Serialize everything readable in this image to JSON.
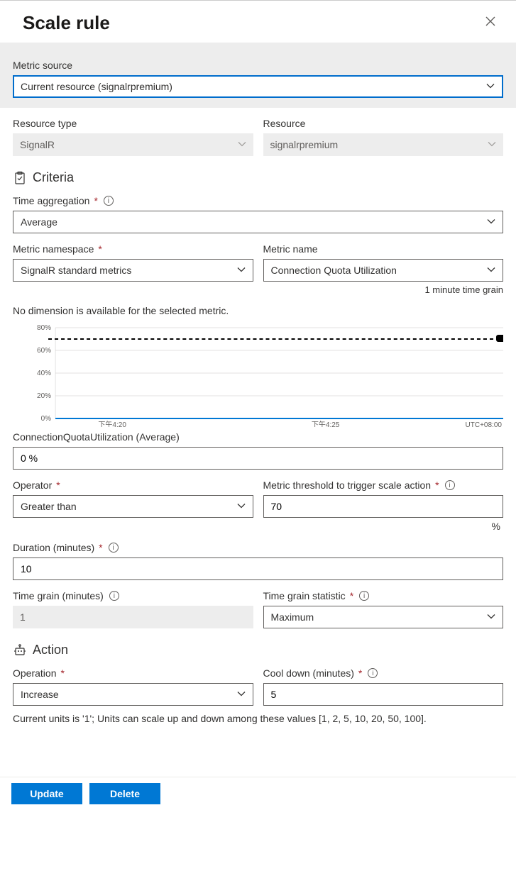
{
  "header": {
    "title": "Scale rule"
  },
  "metric_source": {
    "label": "Metric source",
    "value": "Current resource (signalrpremium)"
  },
  "resource_type": {
    "label": "Resource type",
    "value": "SignalR"
  },
  "resource": {
    "label": "Resource",
    "value": "signalrpremium"
  },
  "criteria": {
    "heading": "Criteria",
    "time_aggregation": {
      "label": "Time aggregation",
      "value": "Average"
    },
    "metric_namespace": {
      "label": "Metric namespace",
      "value": "SignalR standard metrics"
    },
    "metric_name": {
      "label": "Metric name",
      "value": "Connection Quota Utilization",
      "hint": "1 minute time grain"
    },
    "dimension_note": "No dimension is available for the selected metric.",
    "chart_legend": "ConnectionQuotaUtilization (Average)",
    "current_value": "0 %",
    "operator": {
      "label": "Operator",
      "value": "Greater than"
    },
    "threshold": {
      "label": "Metric threshold to trigger scale action",
      "value": "70",
      "unit": "%"
    },
    "duration": {
      "label": "Duration (minutes)",
      "value": "10"
    },
    "time_grain": {
      "label": "Time grain (minutes)",
      "value": "1"
    },
    "time_grain_statistic": {
      "label": "Time grain statistic",
      "value": "Maximum"
    }
  },
  "chart_data": {
    "type": "line",
    "title": "",
    "xlabel": "",
    "ylabel": "",
    "ylim": [
      0,
      80
    ],
    "y_ticks": [
      "0%",
      "20%",
      "40%",
      "60%",
      "80%"
    ],
    "x_ticks": [
      "下午4:20",
      "下午4:25"
    ],
    "timezone": "UTC+08:00",
    "threshold_line": 70,
    "series": [
      {
        "name": "ConnectionQuotaUtilization (Average)",
        "values": [
          0,
          0,
          0,
          0,
          0,
          0,
          0,
          0,
          0,
          0
        ]
      }
    ]
  },
  "action": {
    "heading": "Action",
    "operation": {
      "label": "Operation",
      "value": "Increase"
    },
    "cooldown": {
      "label": "Cool down (minutes)",
      "value": "5"
    },
    "note": "Current units is '1'; Units can scale up and down among these values [1, 2, 5, 10, 20, 50, 100]."
  },
  "footer": {
    "update": "Update",
    "delete": "Delete"
  }
}
